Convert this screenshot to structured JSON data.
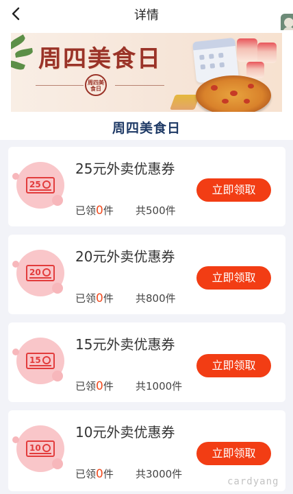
{
  "topbar": {
    "title": "详情"
  },
  "banner": {
    "title": "周四美食日",
    "seal_text": "周四美食日"
  },
  "hero_heading": "周四美食日",
  "coupons": [
    {
      "amount": "25",
      "title": "25元外卖优惠券",
      "claimed_prefix": "已领",
      "claimed_count": "0",
      "claimed_suffix": "件",
      "total": "共500件",
      "button": "立即领取"
    },
    {
      "amount": "20",
      "title": "20元外卖优惠券",
      "claimed_prefix": "已领",
      "claimed_count": "0",
      "claimed_suffix": "件",
      "total": "共800件",
      "button": "立即领取"
    },
    {
      "amount": "15",
      "title": "15元外卖优惠券",
      "claimed_prefix": "已领",
      "claimed_count": "0",
      "claimed_suffix": "件",
      "total": "共1000件",
      "button": "立即领取"
    },
    {
      "amount": "10",
      "title": "10元外卖优惠券",
      "claimed_prefix": "已领",
      "claimed_count": "0",
      "claimed_suffix": "件",
      "total": "共3000件",
      "button": "立即领取"
    }
  ],
  "watermark": "cardyang",
  "colors": {
    "accent": "#f23d14",
    "heading": "#1f3a66",
    "icon_bg": "#f9c6c9",
    "coupon_red": "#e23b3b"
  },
  "icons": {
    "back": "chevron-left-icon",
    "coupon": "coupon-ticket-icon"
  }
}
